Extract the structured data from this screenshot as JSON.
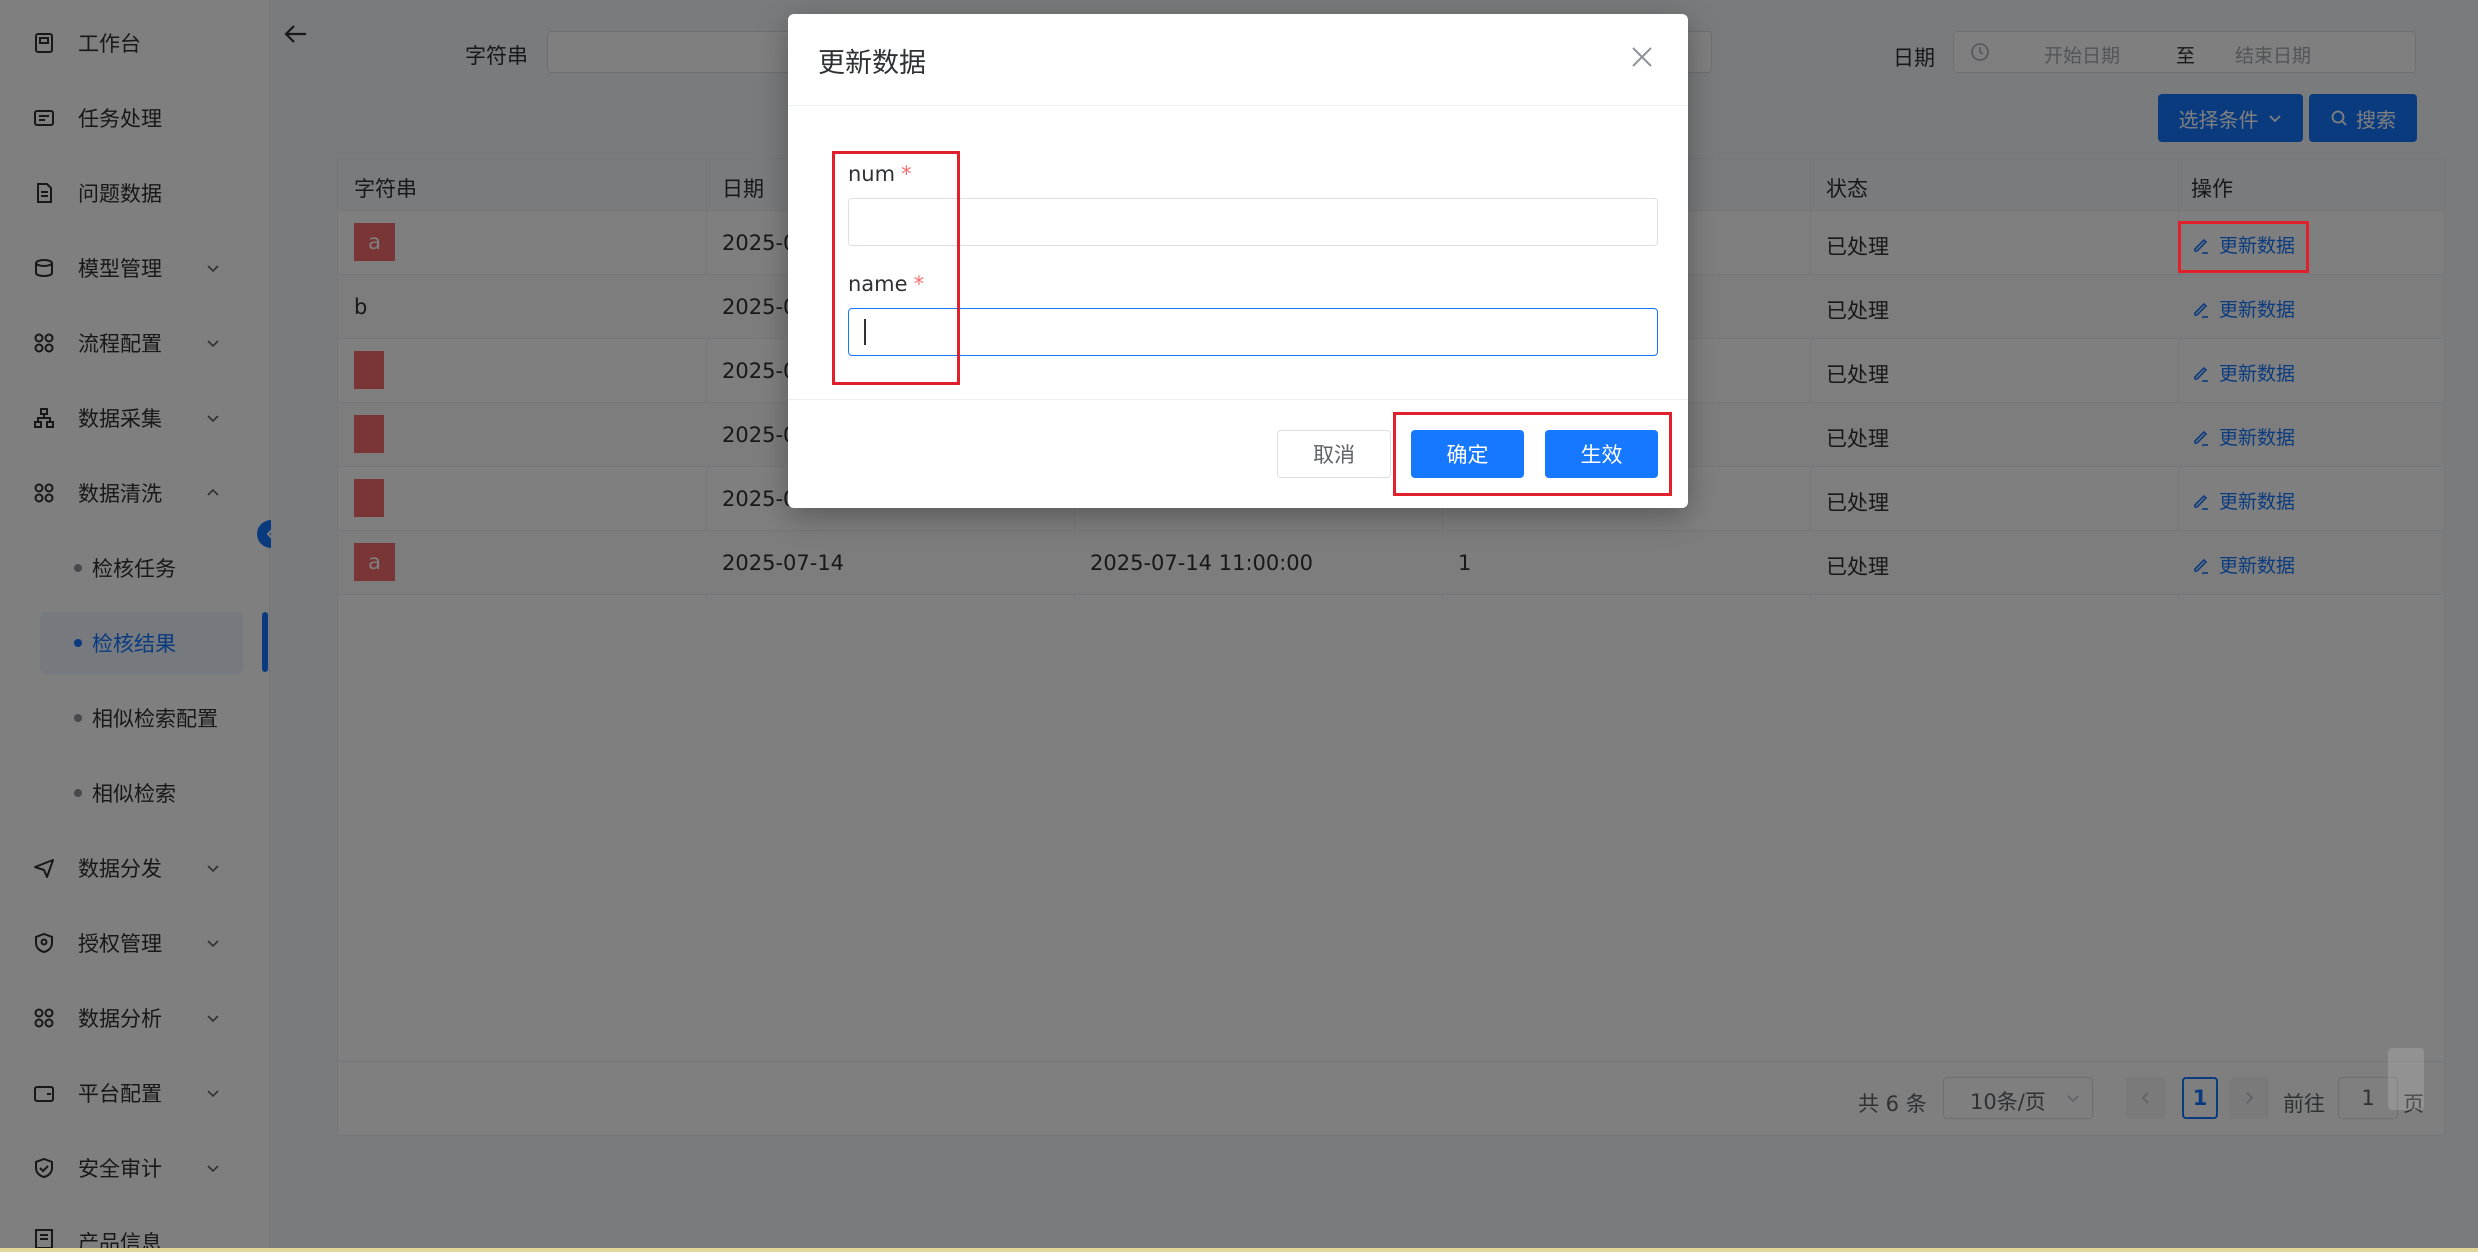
{
  "sidebar": {
    "items": [
      {
        "label": "工作台",
        "icon": "dashboard-icon"
      },
      {
        "label": "任务处理",
        "icon": "task-icon"
      },
      {
        "label": "问题数据",
        "icon": "document-icon"
      },
      {
        "label": "模型管理",
        "icon": "database-icon",
        "expandable": true
      },
      {
        "label": "流程配置",
        "icon": "grid-icon",
        "expandable": true
      },
      {
        "label": "数据采集",
        "icon": "hierarchy-icon",
        "expandable": true
      },
      {
        "label": "数据清洗",
        "icon": "grid-icon",
        "expanded": true
      },
      {
        "label": "数据分发",
        "icon": "send-icon",
        "expandable": true
      },
      {
        "label": "授权管理",
        "icon": "shield-icon",
        "expandable": true
      },
      {
        "label": "数据分析",
        "icon": "grid-icon",
        "expandable": true
      },
      {
        "label": "平台配置",
        "icon": "wallet-icon",
        "expandable": true
      },
      {
        "label": "安全审计",
        "icon": "shield-check-icon",
        "expandable": true
      },
      {
        "label": "产品信息",
        "icon": "list-icon"
      }
    ],
    "sub_items": [
      {
        "label": "检核任务"
      },
      {
        "label": "检核结果",
        "active": true
      },
      {
        "label": "相似检索配置"
      },
      {
        "label": "相似检索"
      }
    ]
  },
  "filters": {
    "string_label": "字符串",
    "date_label": "日期",
    "date_start_placeholder": "开始日期",
    "date_separator": "至",
    "date_end_placeholder": "结束日期",
    "select_condition_label": "选择条件",
    "search_label": "搜索"
  },
  "table": {
    "columns": [
      "字符串",
      "日期",
      "",
      "",
      "状态",
      "操作"
    ],
    "rows": [
      {
        "str": "a",
        "chip": true,
        "date": "2025-0",
        "datetime": "",
        "num": "",
        "status": "已处理",
        "action": "更新数据"
      },
      {
        "str": "b",
        "chip": false,
        "date": "2025-0",
        "datetime": "",
        "num": "",
        "status": "已处理",
        "action": "更新数据"
      },
      {
        "str": "",
        "chip": true,
        "date": "2025-0",
        "datetime": "",
        "num": "",
        "status": "已处理",
        "action": "更新数据"
      },
      {
        "str": "",
        "chip": true,
        "date": "2025-0",
        "datetime": "",
        "num": "",
        "status": "已处理",
        "action": "更新数据"
      },
      {
        "str": "",
        "chip": true,
        "date": "2025-0",
        "datetime": "",
        "num": "",
        "status": "已处理",
        "action": "更新数据"
      },
      {
        "str": "a",
        "chip": true,
        "date": "2025-07-14",
        "datetime": "2025-07-14 11:00:00",
        "num": "1",
        "status": "已处理",
        "action": "更新数据"
      }
    ]
  },
  "pagination": {
    "total": "共 6 条",
    "page_size": "10条/页",
    "current_page": "1",
    "goto_label": "前往",
    "goto_value": "1",
    "page_unit": "页"
  },
  "dialog": {
    "title": "更新数据",
    "fields": [
      {
        "label": "num",
        "required_mark": "*",
        "value": ""
      },
      {
        "label": "name",
        "required_mark": "*",
        "value": ""
      }
    ],
    "cancel_label": "取消",
    "confirm_label": "确定",
    "effect_label": "生效"
  },
  "colors": {
    "primary": "#1677ff",
    "danger": "#f56c6c",
    "annotation": "#e0202a"
  }
}
